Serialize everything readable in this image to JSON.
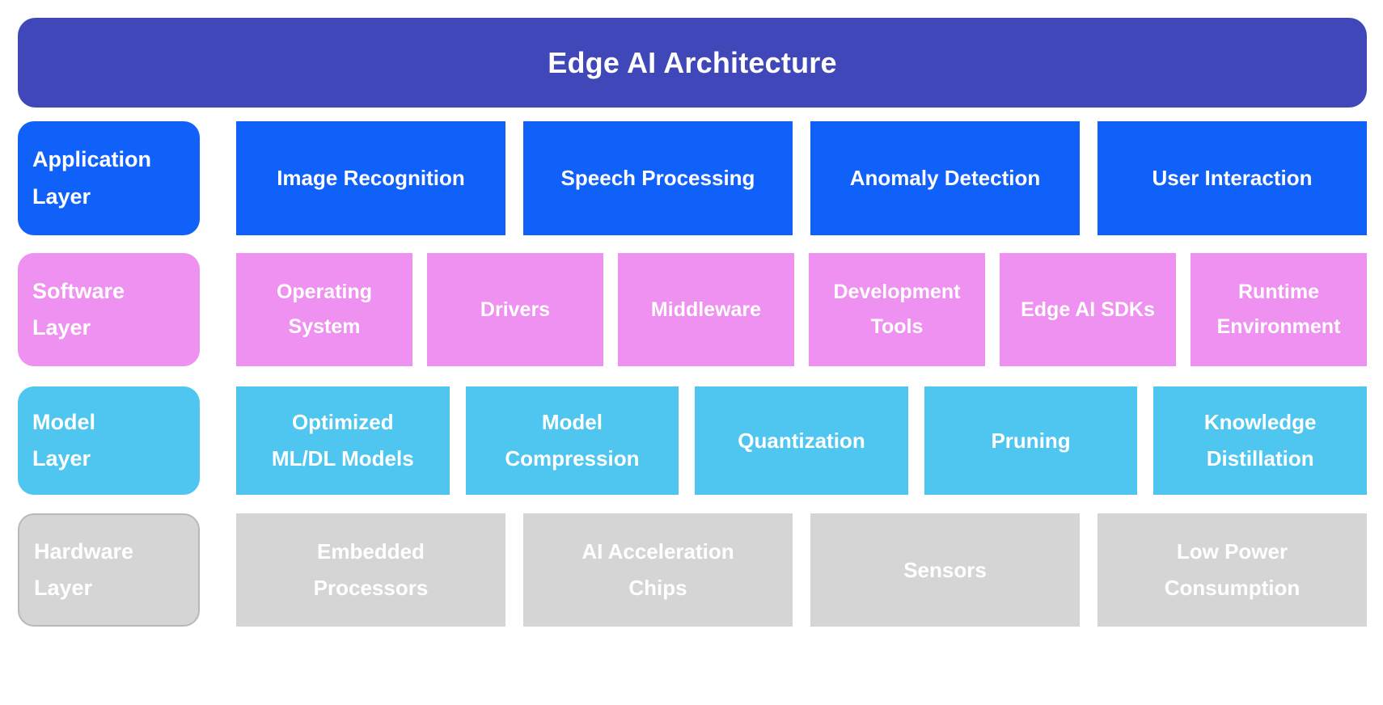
{
  "header": {
    "title": "Edge AI Architecture",
    "color": "#4047b8"
  },
  "layers": [
    {
      "name": "application-layer",
      "label_line1": "Application",
      "label_line2": "Layer",
      "color": "#1060fa",
      "items": [
        {
          "line1": "Image Recognition",
          "line2": ""
        },
        {
          "line1": "Speech Processing",
          "line2": ""
        },
        {
          "line1": "Anomaly Detection",
          "line2": ""
        },
        {
          "line1": "User Interaction",
          "line2": ""
        }
      ]
    },
    {
      "name": "software-layer",
      "label_line1": "Software",
      "label_line2": "Layer",
      "color": "#ee91f0",
      "items": [
        {
          "line1": "Operating",
          "line2": "System"
        },
        {
          "line1": "Drivers",
          "line2": ""
        },
        {
          "line1": "Middleware",
          "line2": ""
        },
        {
          "line1": "Development",
          "line2": "Tools"
        },
        {
          "line1": "Edge AI SDKs",
          "line2": ""
        },
        {
          "line1": "Runtime",
          "line2": "Environment"
        }
      ]
    },
    {
      "name": "model-layer",
      "label_line1": "Model",
      "label_line2": "Layer",
      "color": "#4ec6f0",
      "items": [
        {
          "line1": "Optimized",
          "line2": "ML/DL Models"
        },
        {
          "line1": "Model",
          "line2": "Compression"
        },
        {
          "line1": "Quantization",
          "line2": ""
        },
        {
          "line1": "Pruning",
          "line2": ""
        },
        {
          "line1": "Knowledge",
          "line2": "Distillation"
        }
      ]
    },
    {
      "name": "hardware-layer",
      "label_line1": "Hardware",
      "label_line2": "Layer",
      "color": "#d5d5d5",
      "border_color": "#b9b9b9",
      "items": [
        {
          "line1": "Embedded",
          "line2": "Processors"
        },
        {
          "line1": "AI Acceleration",
          "line2": "Chips"
        },
        {
          "line1": "Sensors",
          "line2": ""
        },
        {
          "line1": "Low Power",
          "line2": "Consumption"
        }
      ]
    }
  ]
}
